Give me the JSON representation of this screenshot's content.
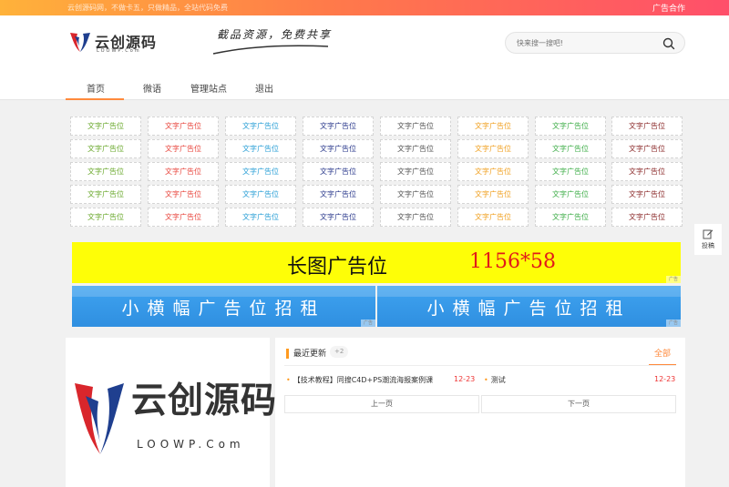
{
  "topbar": {
    "notice": "云创源码网，不做卡五，只做精品，全站代码免费",
    "ad_link": "广告合作"
  },
  "logo": {
    "name": "云创源码",
    "sub": "LOOWP.Com"
  },
  "slogan": "截品资源，免费共享",
  "search": {
    "placeholder": "快来搜一搜吧!"
  },
  "nav": {
    "items": [
      "首页",
      "微语",
      "管理站点",
      "退出"
    ]
  },
  "ad_grid": {
    "label": "文字广告位",
    "columns": 8,
    "rows": 5,
    "colors": [
      "#6aa82c",
      "#e8453c",
      "#2a9fd6",
      "#2b3a8c",
      "#555555",
      "#f0a020",
      "#3fae49",
      "#8b2a2a"
    ]
  },
  "long_banner": {
    "text": "长图广告位",
    "size": "1156*58",
    "tag": "广告"
  },
  "small_banners": [
    {
      "text": "小横幅广告位招租",
      "tag": "广告"
    },
    {
      "text": "小横幅广告位招租",
      "tag": "广告"
    }
  ],
  "big_logo": {
    "name": "云创源码",
    "sub": "LOOWP.Com"
  },
  "recent": {
    "title": "最近更新",
    "count": "+2",
    "all_label": "全部",
    "posts": [
      {
        "title": "【技术教程】同搜C4D+PS潮流海报案例课",
        "date": "12-23"
      },
      {
        "title": "测试",
        "date": "12-23"
      }
    ],
    "prev_label": "上一页",
    "next_label": "下一页"
  },
  "contribute": {
    "label": "投稿"
  },
  "colors": {
    "accent": "#ff8a3c",
    "banner_yellow": "#fefe07",
    "banner_blue": "#3198e6",
    "size_red": "#e21a1a"
  }
}
